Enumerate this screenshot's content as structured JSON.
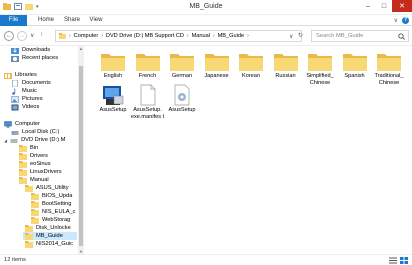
{
  "window": {
    "title": "MB_Guide"
  },
  "ribbon": {
    "tabs": [
      "File",
      "Home",
      "Share",
      "View"
    ],
    "expand": "∨",
    "help": "?"
  },
  "nav": {
    "back": "←",
    "forward": "→",
    "recent": "∨",
    "up": "↑",
    "address": [
      "Computer",
      "DVD Drive (D:) MB Support CD",
      "Manual",
      "MB_Guide"
    ],
    "refresh": "↻",
    "search_placeholder": "Search MB_Guide"
  },
  "sidebar": {
    "items": [
      {
        "label": "Downloads",
        "icon": "downloads-icon"
      },
      {
        "label": "Recent places",
        "icon": "recent-places-icon"
      },
      {
        "label": "Libraries",
        "icon": "libraries-icon"
      },
      {
        "label": "Documents",
        "icon": "documents-icon"
      },
      {
        "label": "Music",
        "icon": "music-icon"
      },
      {
        "label": "Pictures",
        "icon": "pictures-icon"
      },
      {
        "label": "Videos",
        "icon": "videos-icon"
      },
      {
        "label": "Computer",
        "icon": "computer-icon"
      },
      {
        "label": "Local Disk (C:)",
        "icon": "local-disk-icon"
      },
      {
        "label": "DVD Drive (D:) M",
        "icon": "dvd-drive-icon"
      },
      {
        "label": "Bin",
        "icon": "folder-icon"
      },
      {
        "label": "Drivers",
        "icon": "folder-icon"
      },
      {
        "label": "eoSinus",
        "icon": "folder-icon"
      },
      {
        "label": "LinuxDrivers",
        "icon": "folder-icon"
      },
      {
        "label": "Manual",
        "icon": "folder-icon"
      },
      {
        "label": "ASUS_Utility",
        "icon": "folder-icon"
      },
      {
        "label": "BIOS_Upda",
        "icon": "folder-icon"
      },
      {
        "label": "BootSetting",
        "icon": "folder-icon"
      },
      {
        "label": "NIS_EULA_c",
        "icon": "folder-icon"
      },
      {
        "label": "WebStorag",
        "icon": "folder-icon"
      },
      {
        "label": "Disk_Unlocke",
        "icon": "folder-icon"
      },
      {
        "label": "MB_Guide",
        "icon": "folder-icon"
      },
      {
        "label": "NIS2014_Guic",
        "icon": "folder-icon"
      }
    ]
  },
  "content": {
    "folders": [
      "English",
      "French",
      "German",
      "Japanese",
      "Korean",
      "Russian",
      "Simplified_ Chinese",
      "Spanish",
      "Traditional_ Chinese"
    ],
    "files": [
      {
        "label": "AsusSetup",
        "icon": "asus-setup-app-icon"
      },
      {
        "label": "AsusSetup. exe.manifes t",
        "icon": "manifest-file-icon"
      },
      {
        "label": "AsusSetup",
        "icon": "settings-file-icon"
      }
    ]
  },
  "status": {
    "item_count": "12 items"
  },
  "colors": {
    "accent": "#1979ca",
    "close": "#c42b1c",
    "folder": "#f8d775",
    "selected": "#cce8ff"
  }
}
